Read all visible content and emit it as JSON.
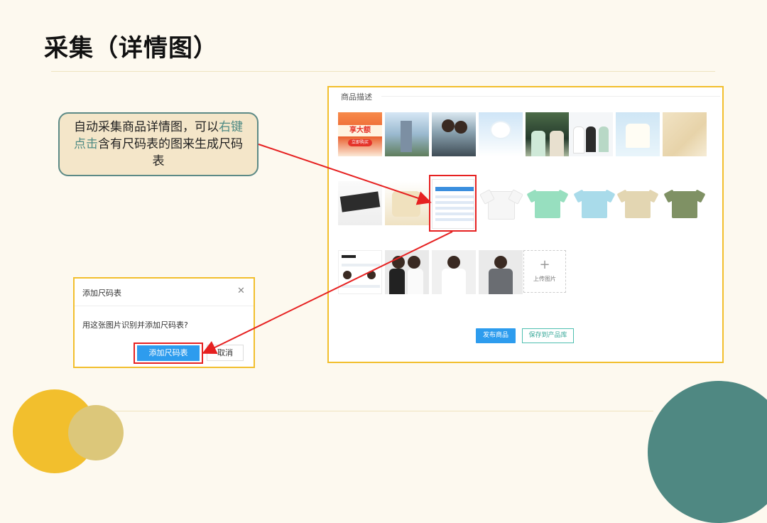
{
  "slide": {
    "title": "采集（详情图）",
    "callout": {
      "part1": "自动采集商品详情图，可以",
      "part2_highlight": "右键点击",
      "part3": "含有尺码表的图来生成尺码表"
    }
  },
  "panel": {
    "section_label": "商品描述",
    "thumbnails": [
      {
        "name": "promo-banner",
        "text": "享大额",
        "sub": "立即购买"
      },
      {
        "name": "building-photo"
      },
      {
        "name": "couple-scooter-photo"
      },
      {
        "name": "cotton-photo"
      },
      {
        "name": "couple-pool-photo"
      },
      {
        "name": "models-lineup-photo"
      },
      {
        "name": "tshirt-sky-photo"
      },
      {
        "name": "fabric-closeup-photo"
      },
      {
        "name": "black-fabric-photo"
      },
      {
        "name": "cream-tshirt-photo"
      },
      {
        "name": "size-chart-image"
      },
      {
        "name": "white-tshirt",
        "color": "#ffffff"
      },
      {
        "name": "mint-tshirt",
        "color": "#97dfbf"
      },
      {
        "name": "lightblue-tshirt",
        "color": "#a9dbea"
      },
      {
        "name": "khaki-tshirt",
        "color": "#e3d6b2"
      },
      {
        "name": "olive-tshirt",
        "color": "#7f9164"
      },
      {
        "name": "detail-info-image"
      },
      {
        "name": "couple-model-photo"
      },
      {
        "name": "white-tee-model-photo"
      },
      {
        "name": "grey-polo-model-photo"
      }
    ],
    "upload_label": "上传图片",
    "publish_button": "发布商品",
    "save_button": "保存到产品库"
  },
  "dialog": {
    "title": "添加尺码表",
    "message": "用这张图片识别并添加尺码表?",
    "confirm_button": "添加尺码表",
    "cancel_button": "取消"
  },
  "icons": {
    "close": "close-icon",
    "plus": "plus-icon"
  },
  "colors": {
    "accent_blue": "#2d9cee",
    "highlight_red": "#e62121",
    "frame_yellow": "#f2bf2d",
    "teal": "#4e8a84"
  }
}
